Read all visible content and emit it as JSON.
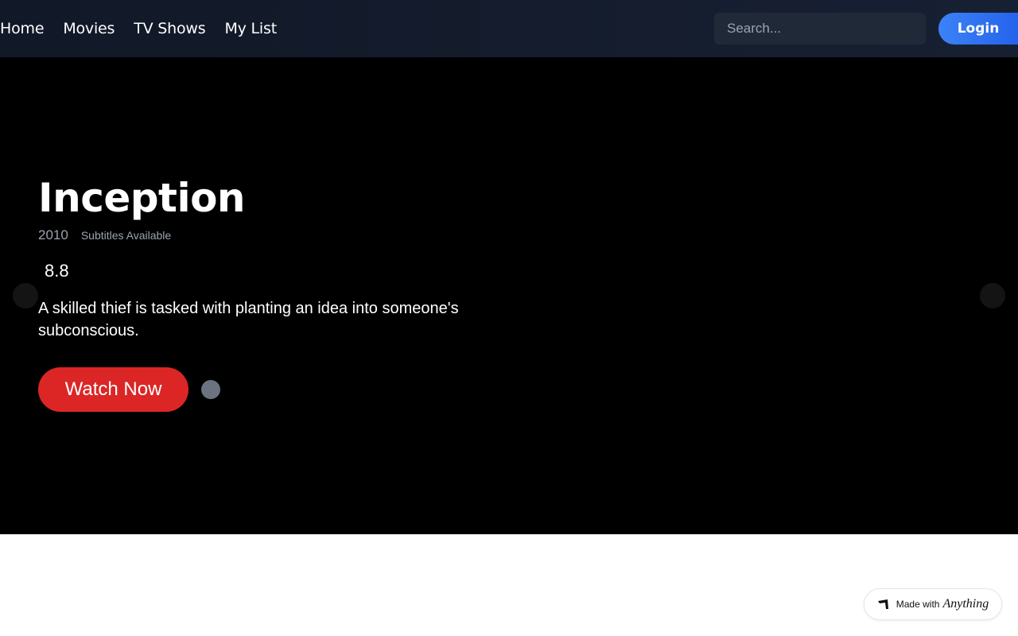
{
  "nav": {
    "items": [
      {
        "label": "Home"
      },
      {
        "label": "Movies"
      },
      {
        "label": "TV Shows"
      },
      {
        "label": "My List"
      }
    ]
  },
  "search": {
    "placeholder": "Search..."
  },
  "auth": {
    "login_label": "Login"
  },
  "hero": {
    "title": "Inception",
    "year": "2010",
    "subtitles": "Subtitles Available",
    "rating": "8.8",
    "description": "A skilled thief is tasked with planting an idea into someone's subconscious.",
    "watch_label": "Watch Now"
  },
  "badge": {
    "text": "Made with",
    "brand": "Anything"
  },
  "colors": {
    "accent": "#dc2626",
    "login": "#3b82f6",
    "header_bg": "#111827"
  },
  "icons": {
    "prev": "chevron-left-icon",
    "next": "chevron-right-icon",
    "badge": "anything-logo-icon"
  }
}
